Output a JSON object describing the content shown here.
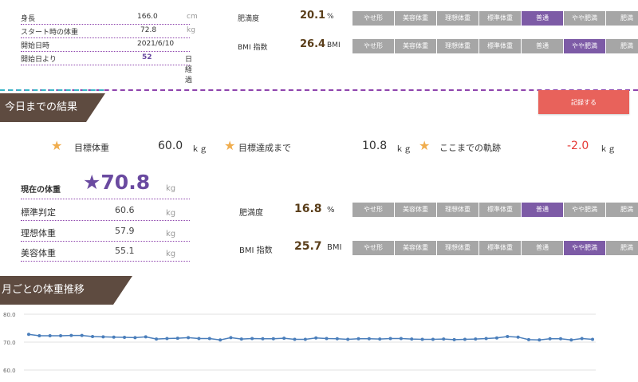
{
  "profile": {
    "rows": [
      {
        "label": "身長",
        "value": "166.0",
        "unit": "cm"
      },
      {
        "label": "スタート時の体重",
        "value": "72.8",
        "unit": "kg"
      },
      {
        "label": "開始日時",
        "value": "2021/6/10",
        "unit": ""
      },
      {
        "label": "開始日より",
        "value": "52",
        "unit": "日経過"
      }
    ]
  },
  "top_metrics": {
    "obesity": {
      "label": "肥満度",
      "value": "20.1",
      "unit": "%"
    },
    "bmi": {
      "label": "BMI 指数",
      "value": "26.4",
      "unit": "BMI"
    }
  },
  "scale_labels": [
    "やせ形",
    "美容体重",
    "理想体重",
    "標準体重",
    "普通",
    "やや肥満",
    "肥満"
  ],
  "scale_state": {
    "top_obesity_active": "普通",
    "top_bmi_active": "やや肥満",
    "bottom_obesity_active": "普通",
    "bottom_bmi_active": "やや肥満"
  },
  "colors": {
    "active": "#7d5ba6",
    "inactive": "#a6a6a6",
    "accent_red": "#e8625b",
    "banner": "#5e4b40"
  },
  "results": {
    "title": "今日までの結果",
    "record_button": "記録する",
    "target_label": "目標体重",
    "target_value": "60.0",
    "target_unit": "ｋｇ",
    "to_goal_label": "目標達成まで",
    "to_goal_value": "10.8",
    "to_goal_unit": "ｋｇ",
    "trajectory_label": "ここまでの軌跡",
    "trajectory_value": "-2.0",
    "trajectory_unit": "ｋｇ"
  },
  "current": {
    "label": "現在の体重",
    "value": "★70.8",
    "unit": "kg",
    "rows": [
      {
        "label": "標準判定",
        "value": "60.6",
        "unit": "kg"
      },
      {
        "label": "理想体重",
        "value": "57.9",
        "unit": "kg"
      },
      {
        "label": "美容体重",
        "value": "55.1",
        "unit": "kg"
      }
    ],
    "obesity": {
      "label": "肥満度",
      "value": "16.8",
      "unit": "%"
    },
    "bmi": {
      "label": "BMI 指数",
      "value": "25.7",
      "unit": "BMI"
    }
  },
  "monthly": {
    "title": "月ごとの体重推移"
  },
  "chart_data": {
    "type": "line",
    "ylim": [
      60,
      80
    ],
    "yticks": [
      "80.0",
      "70.0",
      "60.0"
    ],
    "series": [
      {
        "values": [
          72.8,
          72.3,
          72.3,
          72.3,
          72.4,
          72.4,
          72.0,
          71.9,
          71.8,
          71.7,
          71.6,
          71.9,
          71.1,
          71.3,
          71.4,
          71.6,
          71.3,
          71.3,
          70.8,
          71.6,
          71.1,
          71.3,
          71.2,
          71.2,
          71.4,
          71.0,
          71.0,
          71.5,
          71.3,
          71.2,
          71.0,
          71.2,
          71.2,
          71.1,
          71.3,
          71.3,
          71.1,
          71.0,
          71.0,
          71.1,
          70.9,
          71.0,
          71.1,
          71.3,
          71.5,
          72.0,
          71.8,
          70.9,
          70.8,
          71.2,
          71.2,
          70.8,
          71.3,
          71.0
        ]
      }
    ]
  }
}
